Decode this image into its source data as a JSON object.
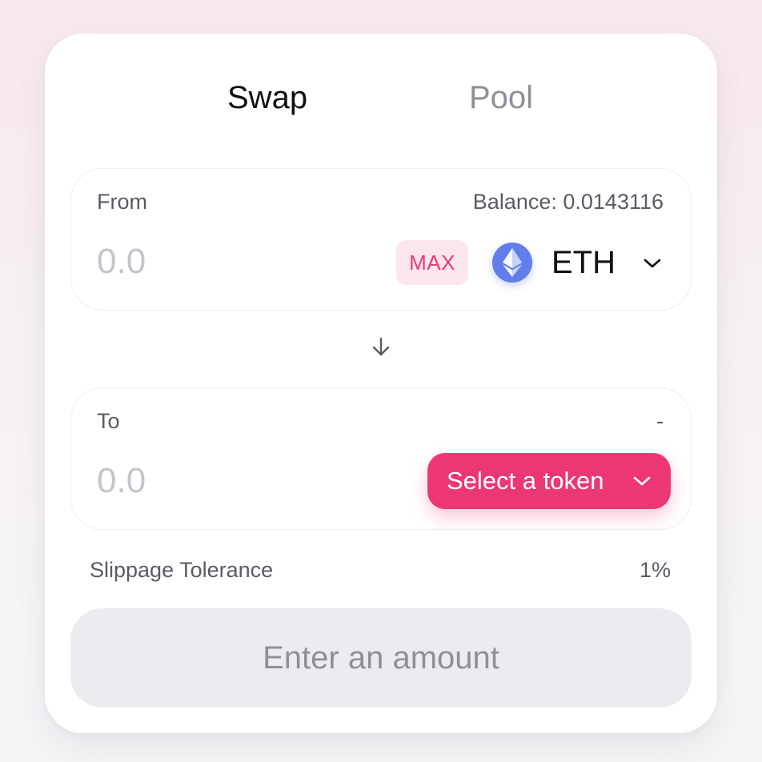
{
  "tabs": {
    "swap": "Swap",
    "pool": "Pool"
  },
  "from": {
    "label": "From",
    "balance": "Balance: 0.0143116",
    "amount_placeholder": "0.0",
    "max_label": "MAX",
    "token": "ETH",
    "token_icon": "ethereum-icon"
  },
  "to": {
    "label": "To",
    "balance": "-",
    "amount_placeholder": "0.0",
    "select_label": "Select a token"
  },
  "slippage": {
    "label": "Slippage Tolerance",
    "value": "1%"
  },
  "submit": {
    "label": "Enter an amount"
  },
  "colors": {
    "accent": "#ec3872",
    "max_bg": "#fce6ee",
    "eth": "#627eea",
    "disabled_bg": "#ececf0"
  }
}
